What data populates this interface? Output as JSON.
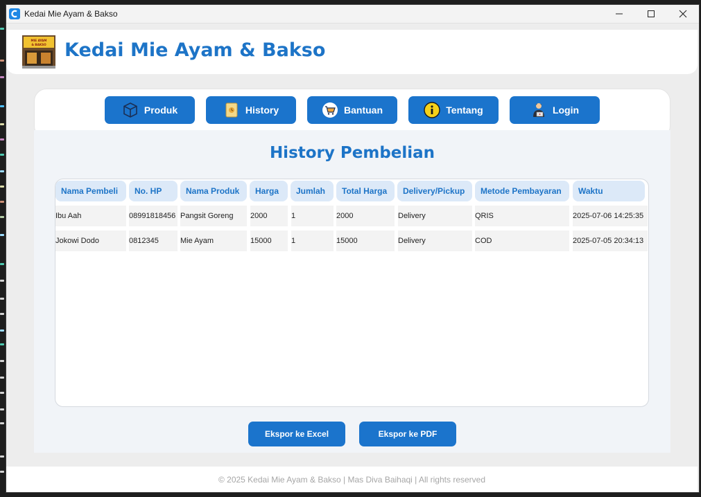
{
  "window": {
    "title": "Kedai Mie Ayam & Bakso"
  },
  "header": {
    "title": "Kedai Mie Ayam & Bakso",
    "logo_text": "MIE AYAM & BAKSO"
  },
  "nav": [
    {
      "label": "Produk",
      "icon": "box-icon"
    },
    {
      "label": "History",
      "icon": "scroll-icon"
    },
    {
      "label": "Bantuan",
      "icon": "cart-icon"
    },
    {
      "label": "Tentang",
      "icon": "info-icon"
    },
    {
      "label": "Login",
      "icon": "user-laptop-icon"
    }
  ],
  "main": {
    "title": "History Pembelian",
    "columns": [
      "Nama Pembeli",
      "No. HP",
      "Nama Produk",
      "Harga",
      "Jumlah",
      "Total Harga",
      "Delivery/Pickup",
      "Metode Pembayaran",
      "Waktu"
    ],
    "rows": [
      [
        "Ibu Aah",
        "08991818456",
        "Pangsit Goreng",
        "2000",
        "1",
        "2000",
        "Delivery",
        "QRIS",
        "2025-07-06 14:25:35"
      ],
      [
        "Jokowi Dodo",
        "0812345",
        "Mie Ayam",
        "15000",
        "1",
        "15000",
        "Delivery",
        "COD",
        "2025-07-05 20:34:13"
      ]
    ],
    "export_excel": "Ekspor ke Excel",
    "export_pdf": "Ekspor ke PDF"
  },
  "footer": {
    "text": "© 2025 Kedai Mie Ayam & Bakso | Mas Diva Baihaqi | All rights reserved"
  },
  "colors": {
    "accent": "#1b74cc",
    "heading": "#1d74c7",
    "header_cell": "#dce9f8"
  }
}
